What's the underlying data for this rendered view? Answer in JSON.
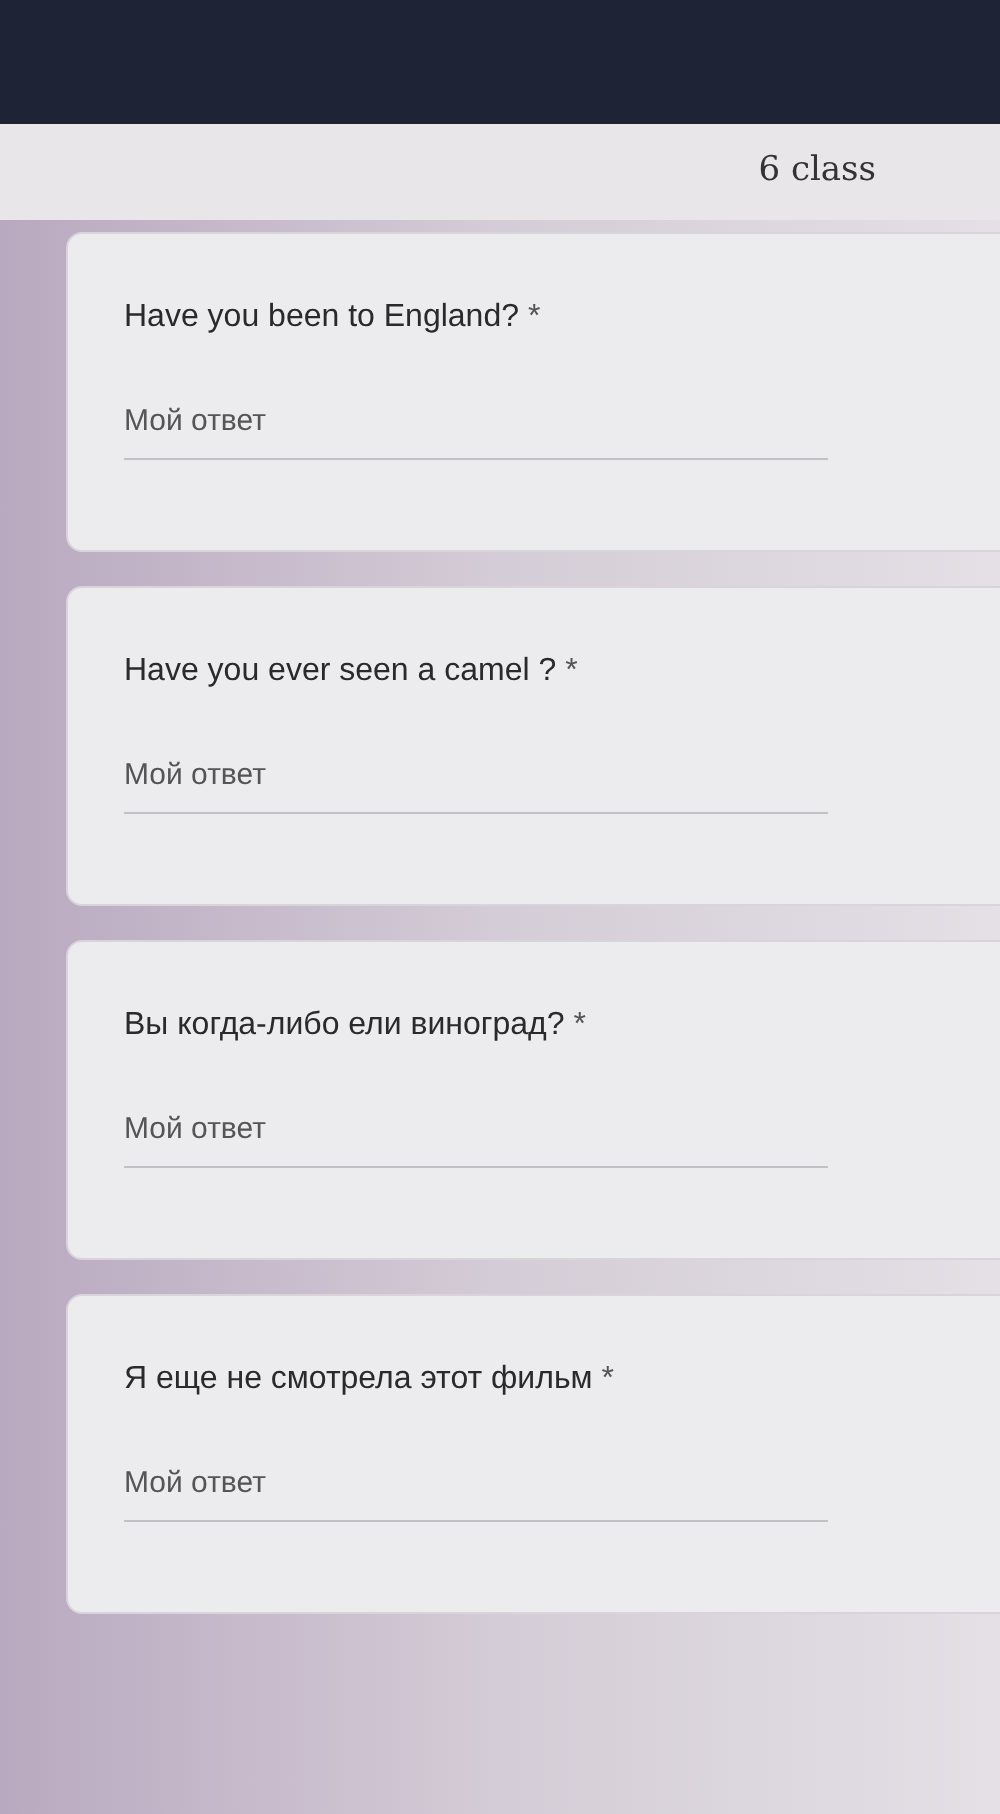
{
  "header": {
    "title": "6 class"
  },
  "questions": [
    {
      "title": "Have you been to England?",
      "required_mark": "*",
      "placeholder": "Мой ответ"
    },
    {
      "title": "Have you ever seen a camel ?",
      "required_mark": "*",
      "placeholder": "Мой ответ"
    },
    {
      "title": "Вы когда-либо ели виноград?",
      "required_mark": "*",
      "placeholder": "Мой ответ"
    },
    {
      "title": "Я еще не смотрела этот фильм",
      "required_mark": "*",
      "placeholder": "Мой ответ"
    }
  ]
}
